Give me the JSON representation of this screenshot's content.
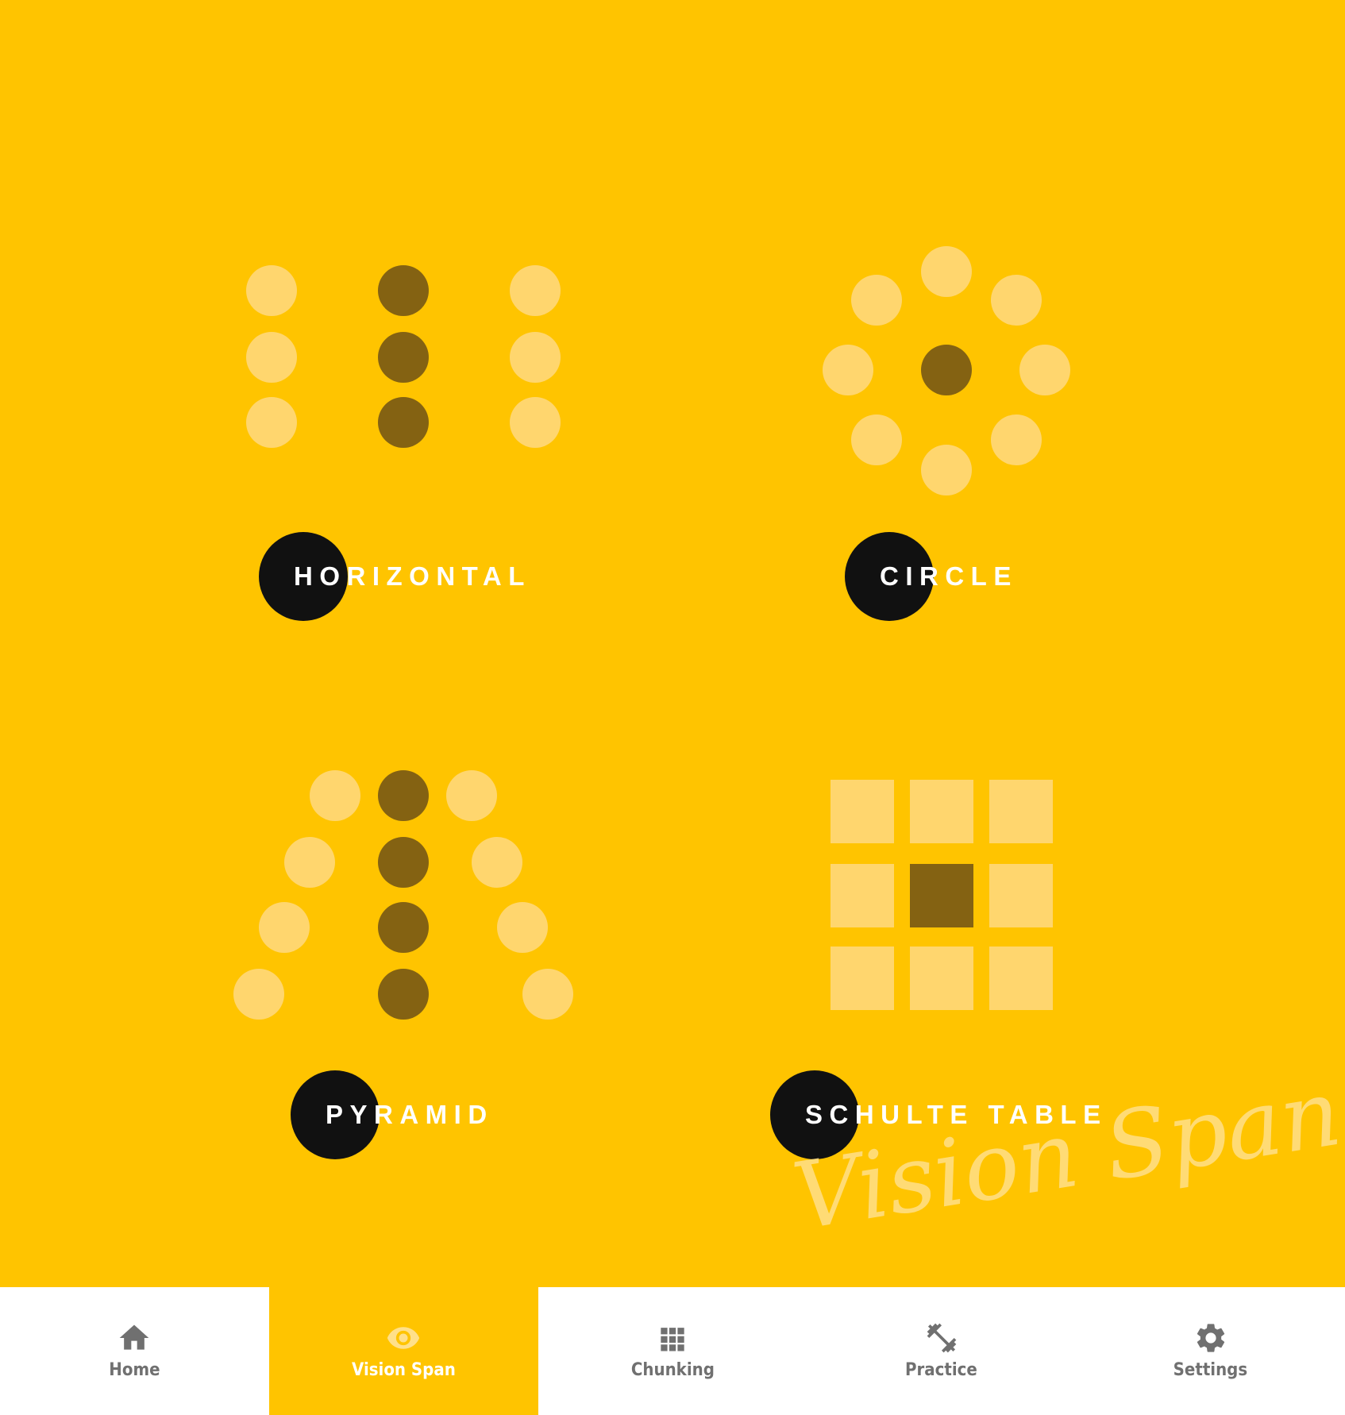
{
  "exercises": [
    {
      "id": "horizontal",
      "label": "HORIZONTAL"
    },
    {
      "id": "circle",
      "label": "CIRCLE"
    },
    {
      "id": "pyramid",
      "label": "PYRAMID"
    },
    {
      "id": "schulte",
      "label": "SCHULTE TABLE"
    }
  ],
  "watermark": "Vision Span",
  "nav": {
    "active_index": 1,
    "items": [
      {
        "label": "Home",
        "icon": "home-icon"
      },
      {
        "label": "Vision Span",
        "icon": "eye-icon"
      },
      {
        "label": "Chunking",
        "icon": "grid-icon"
      },
      {
        "label": "Practice",
        "icon": "dumbbell-icon"
      },
      {
        "label": "Settings",
        "icon": "gear-icon"
      }
    ]
  },
  "colors": {
    "background": "#FFC400",
    "dot_light": "#FFD66E",
    "dot_dark": "#846212",
    "label_blob": "#111111",
    "tab_label": "#707070",
    "tab_active_label": "#FFFFFF"
  }
}
